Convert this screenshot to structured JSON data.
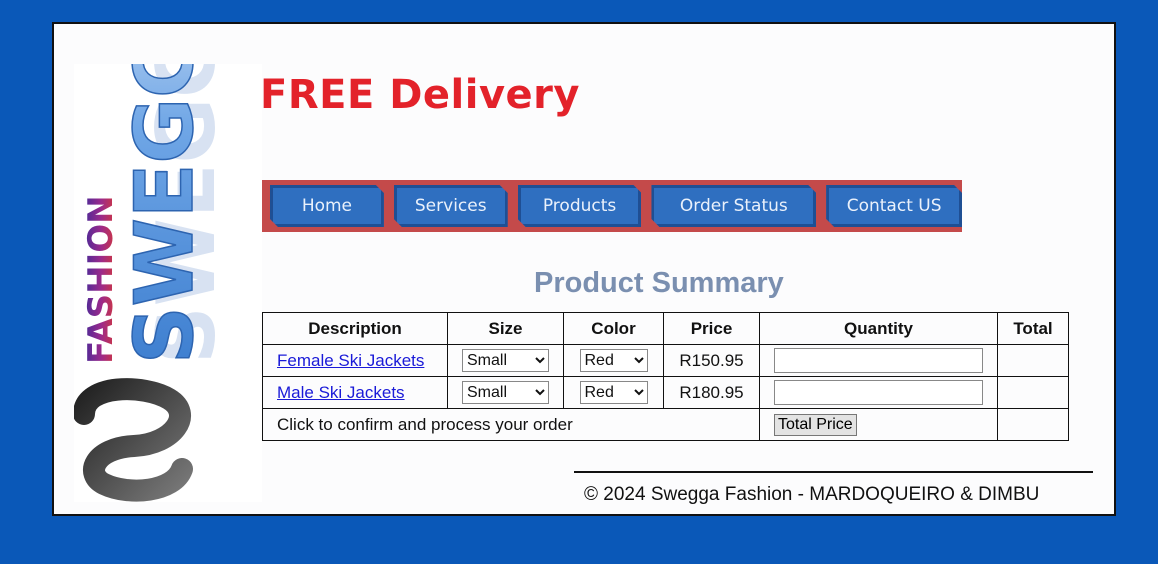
{
  "logo": {
    "brand": "SWEGGA",
    "tagline": "FASHION"
  },
  "headline": "FREE Delivery",
  "nav": [
    {
      "label": "Home"
    },
    {
      "label": "Services"
    },
    {
      "label": "Products"
    },
    {
      "label": "Order Status"
    },
    {
      "label": "Contact US"
    }
  ],
  "summary": {
    "title": "Product Summary",
    "headers": [
      "Description",
      "Size",
      "Color",
      "Price",
      "Quantity",
      "Total"
    ],
    "rows": [
      {
        "description": "Female Ski Jackets",
        "size": "Small",
        "color": "Red",
        "price": "R150.95",
        "quantity": "",
        "total": ""
      },
      {
        "description": "Male Ski Jackets",
        "size": "Small",
        "color": "Red",
        "price": "R180.95",
        "quantity": "",
        "total": ""
      }
    ],
    "confirm_text": "Click to confirm and process your order",
    "total_button": "Total Price"
  },
  "footer": "© 2024 Swegga Fashion - MARDOQUEIRO & DIMBU",
  "colors": {
    "background": "#0a58b8",
    "headline": "#e3222a",
    "nav_bar": "#c44a4a",
    "nav_button": "#2f6fc0",
    "title": "#7a8fb0"
  }
}
